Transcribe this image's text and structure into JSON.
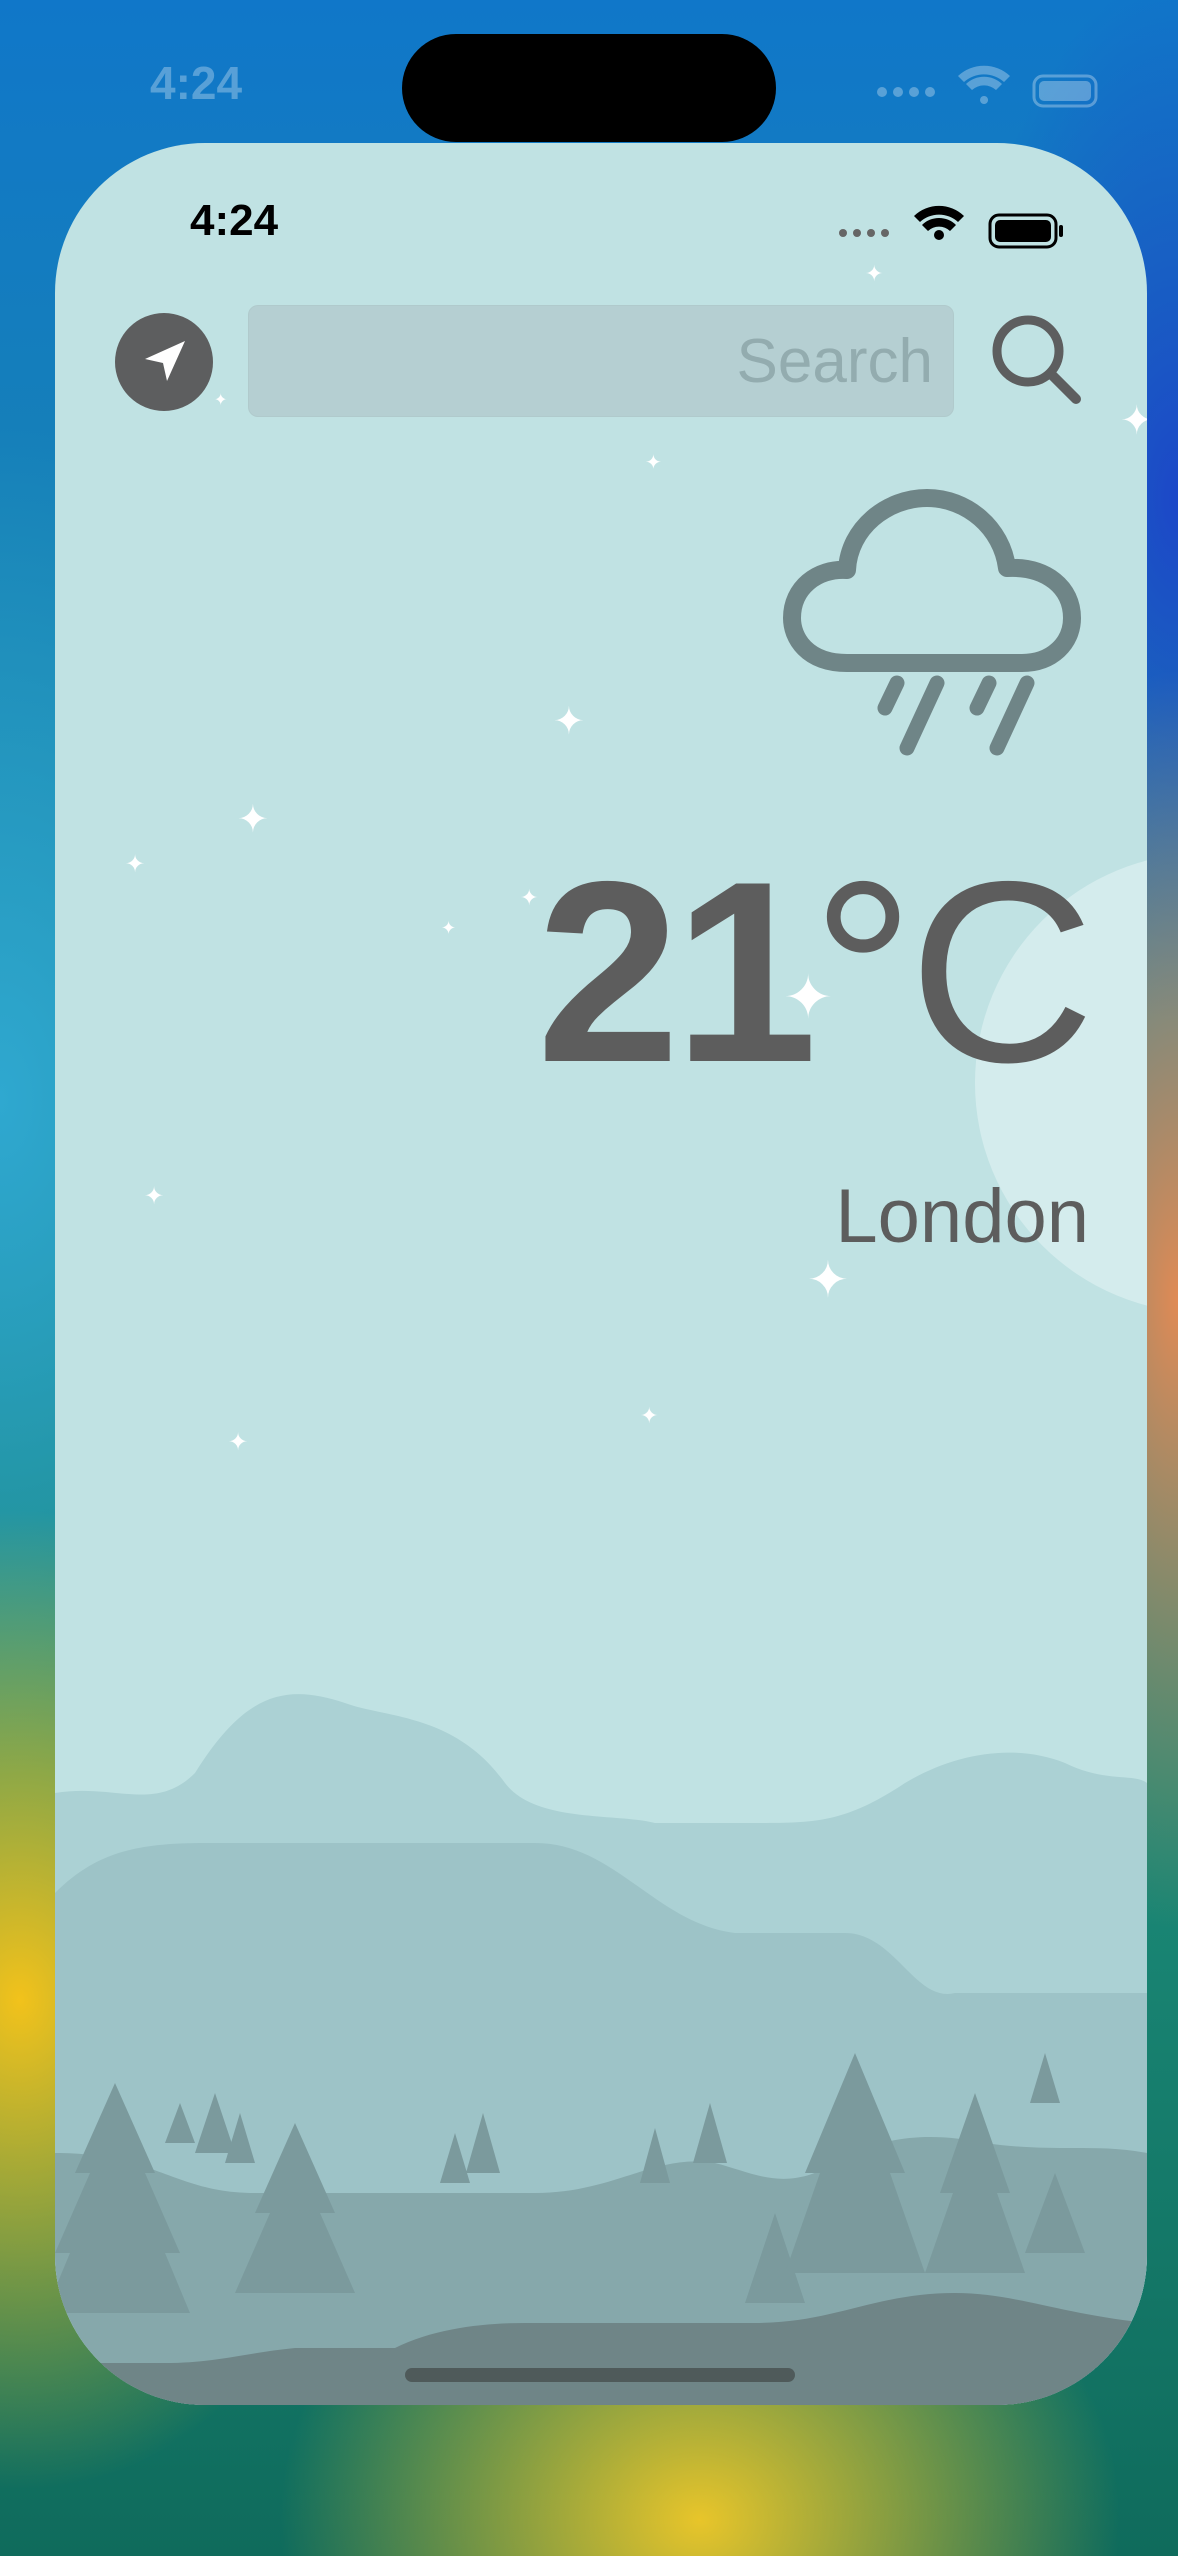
{
  "status_bar": {
    "time": "4:24"
  },
  "search": {
    "placeholder": "Search"
  },
  "weather": {
    "temperature_value": "21",
    "temperature_unit": "°C",
    "city": "London",
    "condition_icon": "cloud-rain-icon"
  },
  "icons": {
    "location": "location-arrow-icon",
    "search": "magnifier-icon"
  },
  "colors": {
    "sky": "#c0e2e3",
    "text": "#5d5d5d",
    "icon": "#6f8587"
  }
}
